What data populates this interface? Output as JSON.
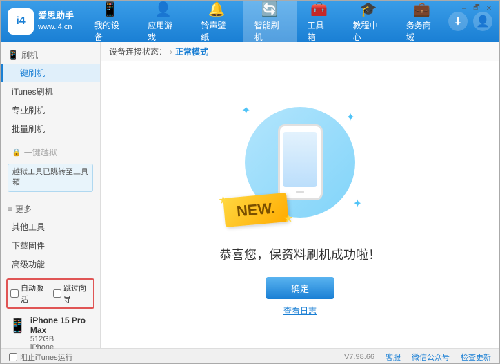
{
  "window": {
    "title": "爱思助手",
    "subtitle": "www.i4.cn"
  },
  "header": {
    "logo_text": "爱思助手",
    "logo_sub": "www.i4.cn",
    "tabs": [
      {
        "id": "my-device",
        "label": "我的设备",
        "icon": "📱"
      },
      {
        "id": "app-game",
        "label": "应用游戏",
        "icon": "👤"
      },
      {
        "id": "ringtone",
        "label": "铃声壁纸",
        "icon": "🔔"
      },
      {
        "id": "smart-flash",
        "label": "智能刷机",
        "icon": "🔄"
      },
      {
        "id": "toolbox",
        "label": "工具箱",
        "icon": "🧰"
      },
      {
        "id": "tutorial",
        "label": "教程中心",
        "icon": "🎓"
      },
      {
        "id": "service",
        "label": "务务商域",
        "icon": "💼"
      }
    ],
    "active_tab": "smart-flash"
  },
  "status_bar": {
    "prefix": "设备连接状态：",
    "status": "正常模式"
  },
  "sidebar": {
    "flash_section": "刷机",
    "items": [
      {
        "id": "one-click-flash",
        "label": "一键刷机",
        "active": true
      },
      {
        "id": "itunes-flash",
        "label": "iTunes刷机"
      },
      {
        "id": "pro-flash",
        "label": "专业刷机"
      },
      {
        "id": "batch-flash",
        "label": "批量刷机"
      }
    ],
    "disabled_label": "一键越狱",
    "jailbreak_notice": "越狱工具已跳转至工具箱",
    "more_section": "更多",
    "more_items": [
      {
        "id": "other-tools",
        "label": "其他工具"
      },
      {
        "id": "download-firmware",
        "label": "下载固件"
      },
      {
        "id": "advanced",
        "label": "高级功能"
      }
    ],
    "auto_activate_label": "自动激活",
    "skip_guide_label": "跳过向导",
    "device": {
      "name": "iPhone 15 Pro Max",
      "storage": "512GB",
      "type": "iPhone"
    },
    "block_itunes_label": "阻止iTunes运行"
  },
  "main": {
    "success_text": "恭喜您，保资料刷机成功啦！",
    "confirm_button": "确定",
    "log_link": "查看日志"
  },
  "footer": {
    "version": "V7.98.66",
    "links": [
      "客服",
      "微信公众号",
      "检查更新"
    ]
  }
}
